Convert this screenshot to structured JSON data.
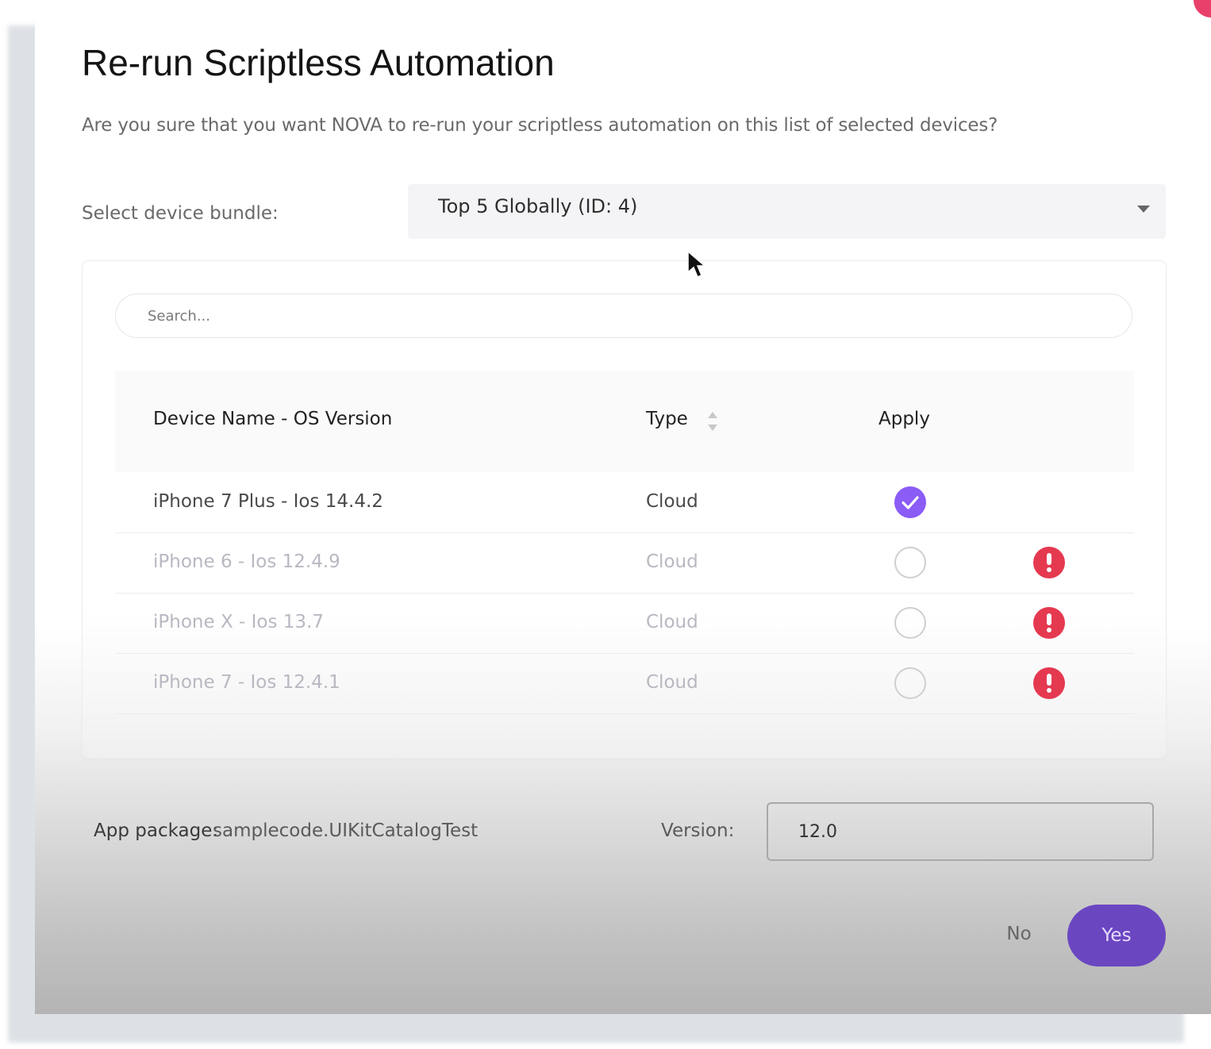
{
  "dialog": {
    "title": "Re-run Scriptless Automation",
    "message": "Are you sure that you want NOVA to re-run your scriptless automation on this list of selected devices?"
  },
  "bundle": {
    "label": "Select device bundle:",
    "selected": "Top 5 Globally (ID: 4)"
  },
  "search": {
    "placeholder": "Search..."
  },
  "table": {
    "columns": [
      "Device Name - OS Version",
      "Type",
      "Apply"
    ],
    "rows": [
      {
        "device": "iPhone 7 Plus - Ios 14.4.2",
        "type": "Cloud",
        "applied": true,
        "enabled": true,
        "warning": false
      },
      {
        "device": "iPhone 6 - Ios 12.4.9",
        "type": "Cloud",
        "applied": false,
        "enabled": false,
        "warning": true
      },
      {
        "device": "iPhone X - Ios 13.7",
        "type": "Cloud",
        "applied": false,
        "enabled": false,
        "warning": true
      },
      {
        "device": "iPhone 7 - Ios 12.4.1",
        "type": "Cloud",
        "applied": false,
        "enabled": false,
        "warning": true
      }
    ]
  },
  "footer": {
    "package_label": "App package:",
    "package_value": "samplecode.UIKitCatalogTest",
    "version_label": "Version:",
    "version_value": "12.0"
  },
  "actions": {
    "no_label": "No",
    "yes_label": "Yes"
  },
  "colors": {
    "accent": "#6b46c1",
    "checked": "#8b5cf6",
    "warning": "#e53950"
  },
  "icons": {
    "dropdown": "chevron-down-icon",
    "sort": "sort-icon",
    "check": "checkmark-icon",
    "warning": "exclamation-icon"
  }
}
